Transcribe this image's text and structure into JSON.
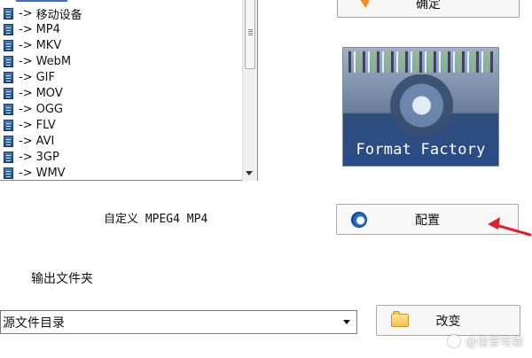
{
  "format_list": {
    "selected_fragment": "自定义",
    "items": [
      {
        "arrow": "->",
        "label": "移动设备"
      },
      {
        "arrow": "->",
        "label": "MP4"
      },
      {
        "arrow": "->",
        "label": "MKV"
      },
      {
        "arrow": "->",
        "label": "WebM"
      },
      {
        "arrow": "->",
        "label": "GIF"
      },
      {
        "arrow": "->",
        "label": "MOV"
      },
      {
        "arrow": "->",
        "label": "OGG"
      },
      {
        "arrow": "->",
        "label": "FLV"
      },
      {
        "arrow": "->",
        "label": "AVI"
      },
      {
        "arrow": "->",
        "label": "3GP"
      },
      {
        "arrow": "->",
        "label": "WMV"
      }
    ]
  },
  "buttons": {
    "ok_label": "确定",
    "config_label": "配置",
    "change_label": "改变"
  },
  "logo": {
    "text": "Format Factory"
  },
  "labels": {
    "custom_profile": "自定义 MPEG4 MP4",
    "output_folder": "输出文件夹"
  },
  "output_select": {
    "value": "源文件目录"
  },
  "watermark": {
    "text": "@信誉可靠"
  },
  "colors": {
    "annotation_arrow": "#e0202a"
  }
}
